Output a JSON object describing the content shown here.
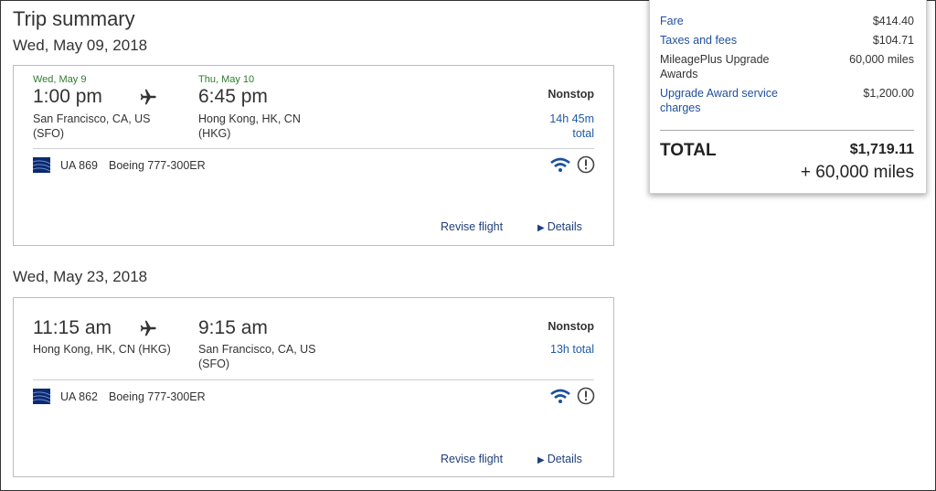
{
  "page": {
    "title": "Trip summary"
  },
  "flights": [
    {
      "date_heading": "Wed, May 09, 2018",
      "departure": {
        "date": "Wed, May 9",
        "time": "1:00 pm",
        "city": "San Francisco, CA, US",
        "code": "(SFO)"
      },
      "arrival": {
        "date": "Thu, May 10",
        "time": "6:45 pm",
        "city": "Hong Kong, HK, CN",
        "code": "(HKG)"
      },
      "stops": "Nonstop",
      "duration_line1": "14h 45m",
      "duration_line2": "total",
      "flight_number": "UA 869",
      "aircraft": "Boeing 777-300ER",
      "revise_label": "Revise flight",
      "details_label": "Details"
    },
    {
      "date_heading": "Wed, May 23, 2018",
      "departure": {
        "time": "11:15 am",
        "city": "Hong Kong, HK, CN (HKG)"
      },
      "arrival": {
        "time": "9:15 am",
        "city": "San Francisco, CA, US",
        "code": "(SFO)"
      },
      "stops": "Nonstop",
      "duration_line1": "13h total",
      "flight_number": "UA 862",
      "aircraft": "Boeing 777-300ER",
      "revise_label": "Revise flight",
      "details_label": "Details"
    }
  ],
  "summary": {
    "rows": [
      {
        "label_1": "Fare",
        "value": "$414.40"
      },
      {
        "label_1": "Taxes and fees",
        "value": "$104.71"
      },
      {
        "label_1": "MileagePlus Upgrade",
        "label_2": "Awards",
        "value": "60,000 miles"
      },
      {
        "label_1": "Upgrade Award service",
        "label_2": "charges",
        "value": "$1,200.00"
      }
    ],
    "total_label": "TOTAL",
    "total_amount": "$1,719.11",
    "total_miles": "+ 60,000 miles"
  },
  "icons": {
    "plane": "plane-icon",
    "wifi": "wifi-icon",
    "info": "info-icon",
    "airline": "united-logo-icon",
    "details": "triangle-right-icon"
  },
  "colors": {
    "link_blue": "#1f3f7a",
    "summary_link": "#1f4f9e",
    "date_green": "#2d7d2d",
    "duration_blue": "#1f5ba8",
    "wifi_blue": "#1a4f9c"
  }
}
